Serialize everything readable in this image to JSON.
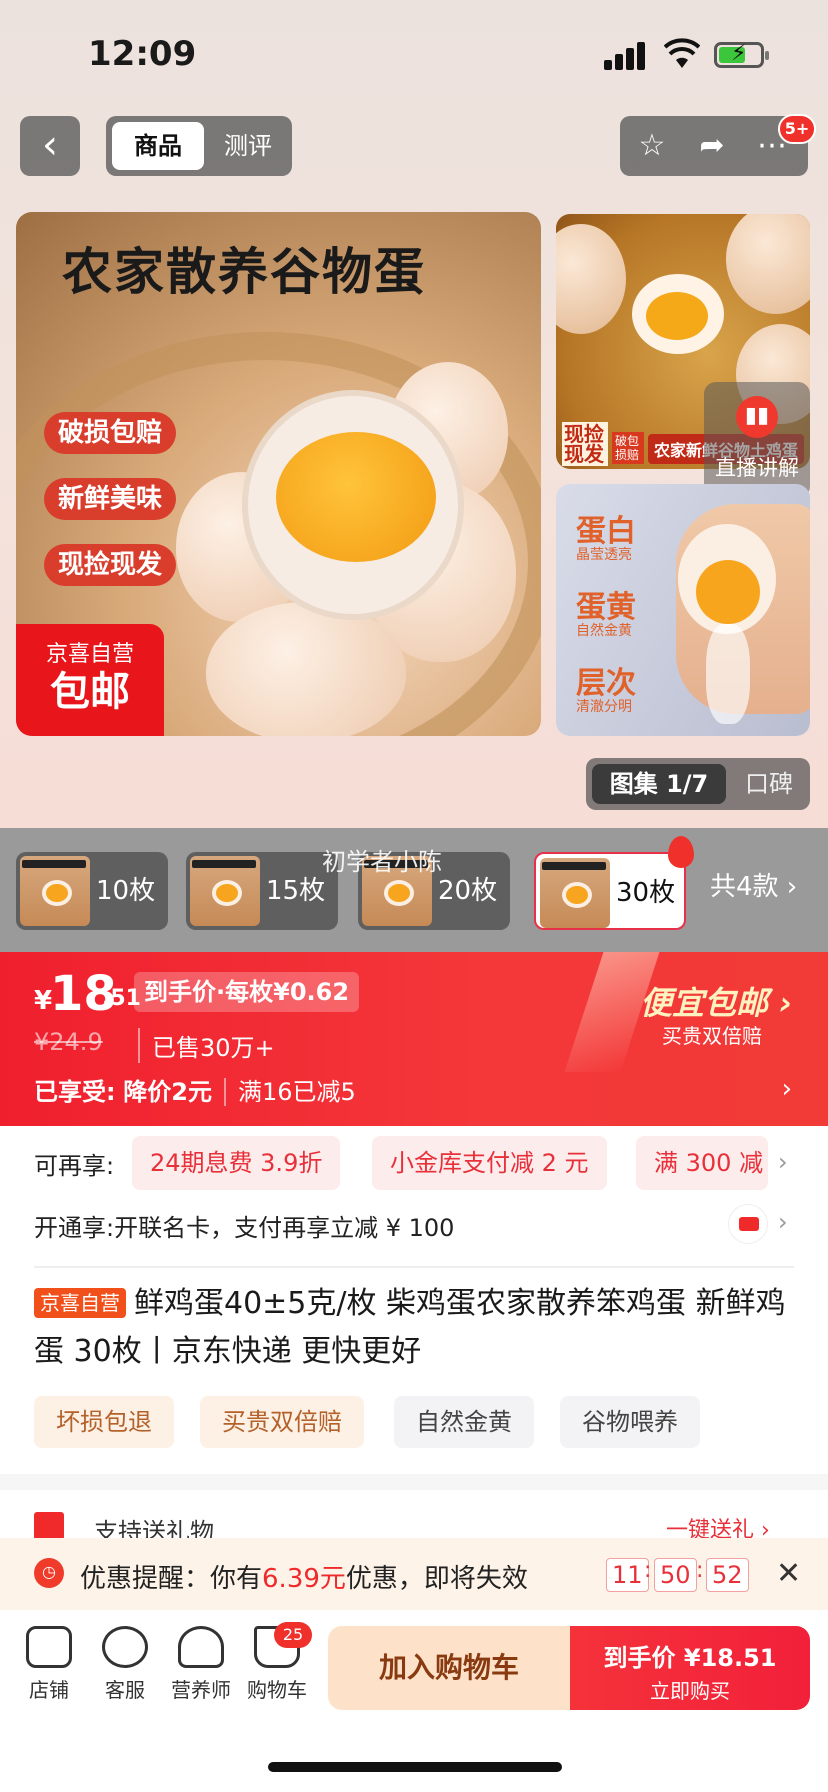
{
  "status": {
    "time": "12:09"
  },
  "nav": {
    "tab_active": "商品",
    "tab_other": "测评",
    "badge": "5+"
  },
  "hero": {
    "title": "农家散养谷物蛋",
    "pills": [
      "破损包赔",
      "新鲜美味",
      "现捡现发"
    ],
    "corner_top": "京喜自营",
    "corner_bottom": "包邮"
  },
  "side_image_1": {
    "label_a": "现捡现发",
    "label_b": "破包损赔",
    "label_c": "农家新鲜谷物土鸡蛋"
  },
  "live": {
    "label": "直播讲解"
  },
  "side_image_2": {
    "features": [
      {
        "word": "蛋白",
        "sub": "晶莹透亮"
      },
      {
        "word": "蛋黄",
        "sub": "自然金黄"
      },
      {
        "word": "层次",
        "sub": "清澈分明"
      }
    ]
  },
  "gallery": {
    "active": "图集 1/7",
    "other": "口碑"
  },
  "variants": {
    "items": [
      "10枚",
      "15枚",
      "20枚",
      "30枚"
    ],
    "total": "共4款 ›",
    "watermark": "初学者小陈"
  },
  "price": {
    "yen": "¥",
    "int": "18",
    "dec": ".51",
    "unit_price": "到手价·每枚¥0.62",
    "original": "¥24.9",
    "sold": "已售30万+",
    "enjoyed_label": "已享受:",
    "promo1": "降价2元",
    "promo2": "满16已减5",
    "free_shipping": "便宜包邮 ›",
    "free_sub": "买贵双倍赔"
  },
  "benefits": {
    "label": "可再享:",
    "tags": [
      "24期息费 3.9折",
      "小金库支付减 2 元",
      "满 300 减"
    ]
  },
  "card_row": {
    "text": "开通享:开联名卡，支付再享立减 ¥ 100"
  },
  "product": {
    "self_tag": "京喜自营",
    "title": "鲜鸡蛋40±5克/枚 柴鸡蛋农家散养笨鸡蛋 新鲜鸡蛋 30枚丨京东快递 更快更好",
    "features": [
      "坏损包退",
      "买贵双倍赔",
      "自然金黄",
      "谷物喂养"
    ]
  },
  "gift": {
    "text": "支持送礼物",
    "action": "一键送礼 ›"
  },
  "reminder": {
    "prefix": "优惠提醒：你有",
    "amount": "6.39元",
    "suffix": "优惠，即将失效",
    "hh": "11",
    "mm": "50",
    "ss": "52"
  },
  "bottom_bar": {
    "icons": [
      {
        "name": "店铺",
        "icon": "store-icon"
      },
      {
        "name": "客服",
        "icon": "service-icon"
      },
      {
        "name": "营养师",
        "icon": "nutritionist-icon"
      },
      {
        "name": "购物车",
        "icon": "cart-icon"
      }
    ],
    "cart_count": "25",
    "add_cart": "加入购物车",
    "buy_top": "到手价 ¥18.51",
    "buy_bottom": "立即购买"
  },
  "colors": {
    "accent": "#f02a2a",
    "brand_orange": "#f2501b"
  }
}
